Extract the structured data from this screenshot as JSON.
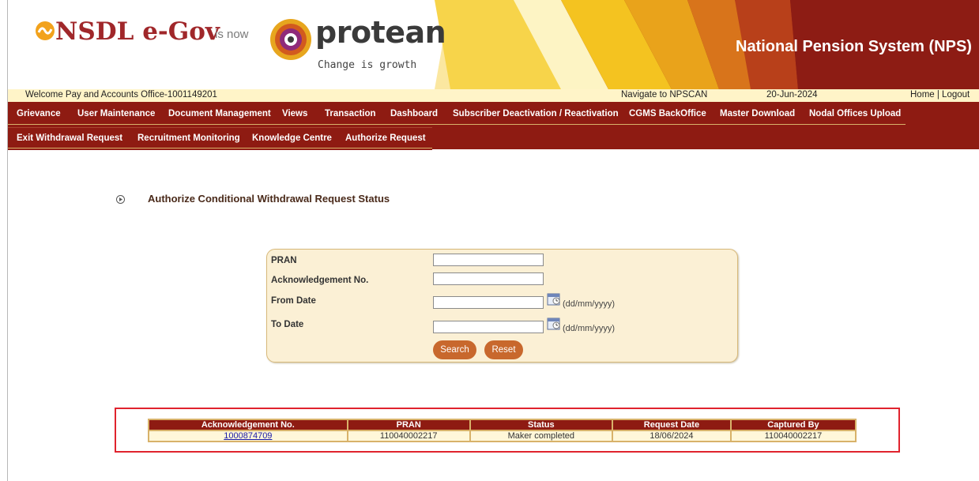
{
  "header": {
    "nsdl_brand": "NSDL e-Gov",
    "is_now": "is now",
    "protean_brand": "protean",
    "protean_tagline": "Change is growth",
    "system_title": "National Pension System (NPS)"
  },
  "welcome_bar": {
    "welcome": "Welcome Pay and Accounts Office-1001149201",
    "navigate_link": "Navigate to NPSCAN",
    "date": "20-Jun-2024",
    "home_logout": "Home | Logout"
  },
  "nav_row1": [
    "Grievance",
    "User Maintenance",
    "Document Management",
    "Views",
    "Transaction",
    "Dashboard",
    "Subscriber Deactivation / Reactivation",
    "CGMS BackOffice",
    "Master Download",
    "Nodal Offices Upload"
  ],
  "nav_row2": [
    "Exit Withdrawal Request",
    "Recruitment Monitoring",
    "Knowledge Centre",
    "Authorize Request"
  ],
  "page": {
    "title": "Authorize Conditional Withdrawal Request Status"
  },
  "form": {
    "pran_label": "PRAN",
    "pran_value": "",
    "ack_label": "Acknowledgement No.",
    "ack_value": "",
    "from_label": "From Date",
    "from_value": "",
    "to_label": "To Date",
    "to_value": "",
    "date_format": "(dd/mm/yyyy)",
    "search_button": "Search",
    "reset_button": "Reset"
  },
  "results": {
    "headers": [
      "Acknowledgement No.",
      "PRAN",
      "Status",
      "Request Date",
      "Captured By"
    ],
    "rows": [
      [
        "1000874709",
        "110040002217",
        "Maker completed",
        "18/06/2024",
        "110040002217"
      ]
    ]
  },
  "colors": {
    "nav_background": "#8e1b12",
    "form_background": "#fbf0d5",
    "button": "#c8682d",
    "highlight_outline": "#e0232e"
  }
}
